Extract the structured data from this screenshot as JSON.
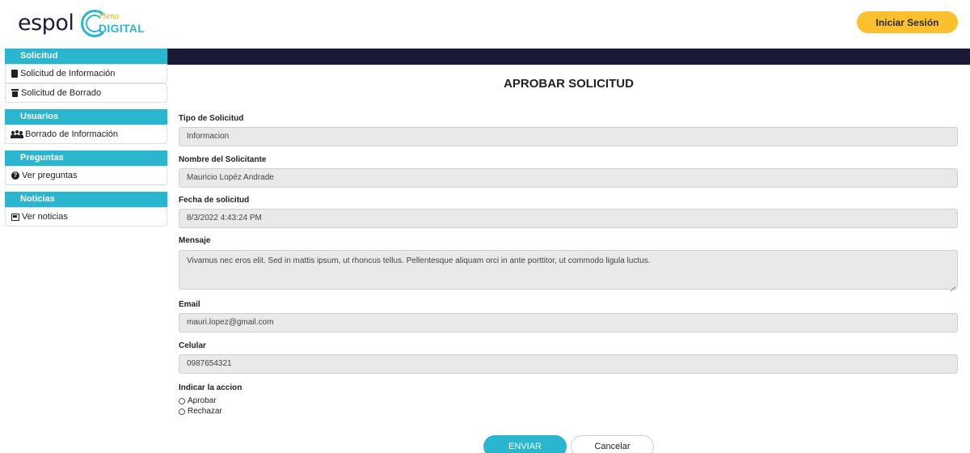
{
  "header": {
    "logo_text": "espol",
    "logo2_script": "Plena",
    "logo2_word": "DIGITAL",
    "login_label": "Iniciar Sesión"
  },
  "sidebar": {
    "sections": [
      {
        "title": "Solicitud",
        "items": [
          {
            "label": "Solicitud de Información",
            "icon": "file-icon"
          },
          {
            "label": "Solicitud de Borrado",
            "icon": "trash-icon"
          }
        ]
      },
      {
        "title": "Usuarios",
        "items": [
          {
            "label": "Borrado de Información",
            "icon": "users-icon"
          }
        ]
      },
      {
        "title": "Preguntas",
        "items": [
          {
            "label": "Ver preguntas",
            "icon": "question-icon"
          }
        ]
      },
      {
        "title": "Noticias",
        "items": [
          {
            "label": "Ver noticias",
            "icon": "newspaper-icon"
          }
        ]
      }
    ]
  },
  "form": {
    "title": "APROBAR SOLICITUD",
    "tipo_label": "Tipo de Solicitud",
    "tipo_value": "Informacion",
    "nombre_label": "Nombre del Solicitante",
    "nombre_value": "Mauricio Lopéz Andrade",
    "fecha_label": "Fecha de solicitud",
    "fecha_value": "8/3/2022 4:43:24 PM",
    "mensaje_label": "Mensaje",
    "mensaje_value": "Vivamus nec eros elit. Sed in mattis ipsum, ut rhoncus tellus. Pellentesque aliquam orci in ante porttitor, ut commodo ligula luctus.",
    "email_label": "Email",
    "email_value": "mauri.lopez@gmail.com",
    "celular_label": "Celular",
    "celular_value": "0987654321",
    "accion_label": "Indicar la accion",
    "opt_aprobar": "Aprobar",
    "opt_rechazar": "Rechazar",
    "send_label": "ENVIAR",
    "cancel_label": "Cancelar"
  },
  "colors": {
    "accent": "#2bb6cf",
    "login": "#fbc02d",
    "topbar": "#1a1936"
  }
}
